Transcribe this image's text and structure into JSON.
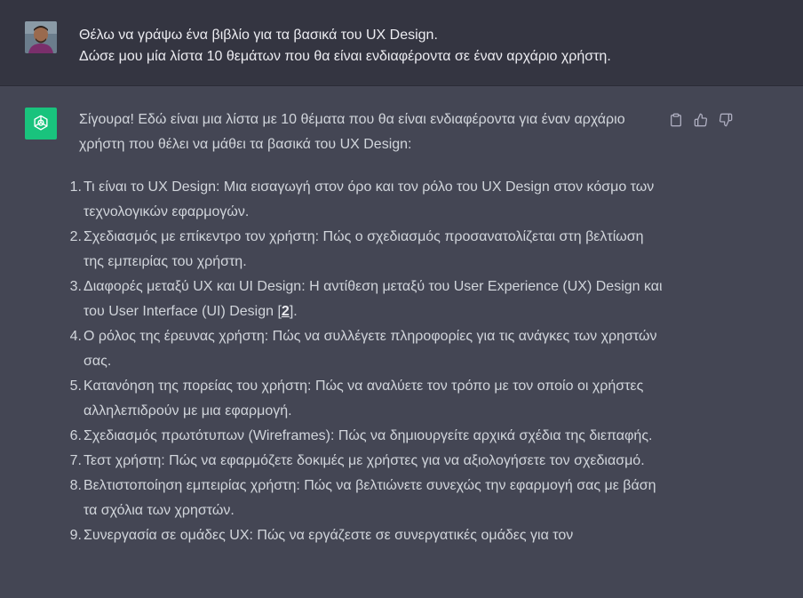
{
  "user_message": {
    "lines": [
      "Θέλω να γράψω ένα βιβλίο για τα βασικά του UX Design.",
      "Δώσε μου μία λίστα 10 θεμάτων που θα είναι ενδιαφέροντα σε έναν αρχάριο χρήστη."
    ]
  },
  "assistant_message": {
    "intro": "Σίγουρα! Εδώ είναι μια λίστα με 10 θέματα που θα είναι ενδιαφέροντα για έναν αρχάριο χρήστη που θέλει να μάθει τα βασικά του UX Design:",
    "items": [
      {
        "num": "1.",
        "text": "Τι είναι το UX Design: Μια εισαγωγή στον όρο και τον ρόλο του UX Design στον κόσμο των τεχνολογικών εφαρμογών."
      },
      {
        "num": "2.",
        "text": "Σχεδιασμός με επίκεντρο τον χρήστη: Πώς ο σχεδιασμός προσανατολίζεται στη βελτίωση της εμπειρίας του χρήστη."
      },
      {
        "num": "3.",
        "text": "Διαφορές μεταξύ UX και UI Design: Η αντίθεση μεταξύ του User Experience (UX) Design και του User Interface (UI) Design [",
        "cite": "2",
        "after": "]."
      },
      {
        "num": "4.",
        "text": "Ο ρόλος της έρευνας χρήστη: Πώς να συλλέγετε πληροφορίες για τις ανάγκες των χρηστών σας."
      },
      {
        "num": "5.",
        "text": "Κατανόηση της πορείας του χρήστη: Πώς να αναλύετε τον τρόπο με τον οποίο οι χρήστες αλληλεπιδρούν με μια εφαρμογή."
      },
      {
        "num": "6.",
        "text": "Σχεδιασμός πρωτότυπων (Wireframes): Πώς να δημιουργείτε αρχικά σχέδια της διεπαφής."
      },
      {
        "num": "7.",
        "text": "Τεστ χρήστη: Πώς να εφαρμόζετε δοκιμές με χρήστες για να αξιολογήσετε τον σχεδιασμό."
      },
      {
        "num": "8.",
        "text": "Βελτιστοποίηση εμπειρίας χρήστη: Πώς να βελτιώνετε συνεχώς την εφαρμογή σας με βάση τα σχόλια των χρηστών."
      },
      {
        "num": "9.",
        "text": "Συνεργασία σε ομάδες UX: Πώς να εργάζεστε σε συνεργατικές ομάδες για τον"
      }
    ]
  },
  "actions": {
    "icons": [
      "clipboard-icon",
      "thumbs-up-icon",
      "thumbs-down-icon"
    ]
  },
  "colors": {
    "user_bg": "#343541",
    "assistant_bg": "#444654",
    "bot_avatar": "#19c37d",
    "text": "#d1d5db"
  }
}
